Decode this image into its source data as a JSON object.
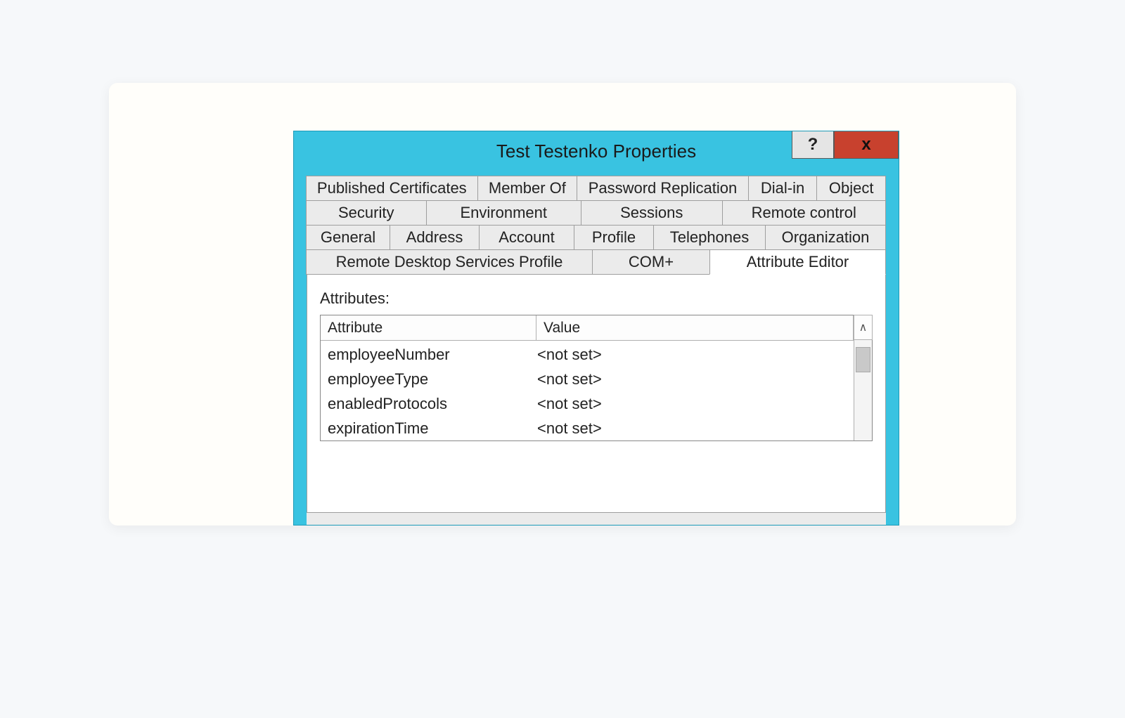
{
  "titlebar": {
    "title": "Test Testenko Properties",
    "help_label": "?",
    "close_label": "x"
  },
  "tabs": {
    "row1": [
      "Published Certificates",
      "Member Of",
      "Password Replication",
      "Dial-in",
      "Object"
    ],
    "row2": [
      "Security",
      "Environment",
      "Sessions",
      "Remote control"
    ],
    "row3": [
      "General",
      "Address",
      "Account",
      "Profile",
      "Telephones",
      "Organization"
    ],
    "row4": [
      "Remote Desktop Services Profile",
      "COM+",
      "Attribute Editor"
    ]
  },
  "panel": {
    "attributes_label": "Attributes:",
    "header_attribute": "Attribute",
    "header_value": "Value",
    "scroll_up_glyph": "∧",
    "rows": [
      {
        "name": "employeeNumber",
        "value": "<not set>"
      },
      {
        "name": "employeeType",
        "value": "<not set>"
      },
      {
        "name": "enabledProtocols",
        "value": "<not set>"
      },
      {
        "name": "expirationTime",
        "value": "<not set>"
      }
    ]
  }
}
